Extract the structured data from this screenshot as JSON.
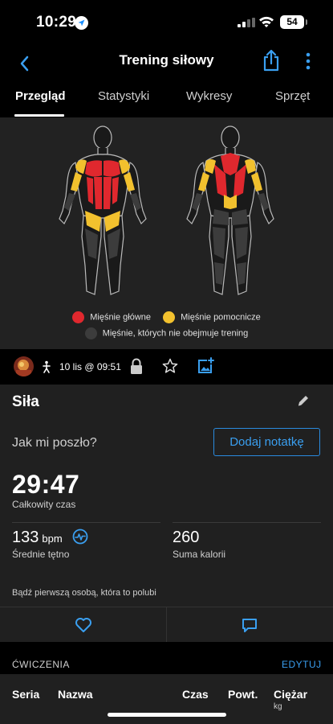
{
  "status_bar": {
    "time": "10:29",
    "battery": "54"
  },
  "nav": {
    "title": "Trening siłowy"
  },
  "tabs": [
    {
      "label": "Przegląd",
      "active": true
    },
    {
      "label": "Statystyki",
      "active": false
    },
    {
      "label": "Wykresy",
      "active": false
    },
    {
      "label": "Sprzęt",
      "active": false
    }
  ],
  "legend": {
    "primary": {
      "label": "Mięśnie główne",
      "color": "#e0282e"
    },
    "secondary": {
      "label": "Mięśnie pomocnicze",
      "color": "#f2c12e"
    },
    "inactive": {
      "label": "Mięśnie, których nie obejmuje trening",
      "color": "#3c3c3c"
    }
  },
  "info": {
    "date": "10 lis @ 09:51"
  },
  "activity": {
    "name": "Siła",
    "how_went": "Jak mi poszło?",
    "add_note": "Dodaj notatkę",
    "total_time": "29:47",
    "total_time_label": "Całkowity czas",
    "avg_hr": "133",
    "avg_hr_unit": "bpm",
    "avg_hr_label": "Średnie tętno",
    "calories": "260",
    "calories_label": "Suma kalorii",
    "like_prompt": "Bądź pierwszą osobą, która to polubi"
  },
  "exercises": {
    "title": "ĆWICZENIA",
    "edit": "EDYTUJ",
    "columns": {
      "set": "Seria",
      "name": "Nazwa",
      "time": "Czas",
      "reps": "Powt.",
      "weight": "Ciężar",
      "weight_unit": "kg"
    }
  },
  "colors": {
    "accent": "#3a9ff0",
    "primary_muscle": "#e0282e",
    "secondary_muscle": "#f2c12e",
    "inactive_muscle": "#3c3c3c"
  }
}
